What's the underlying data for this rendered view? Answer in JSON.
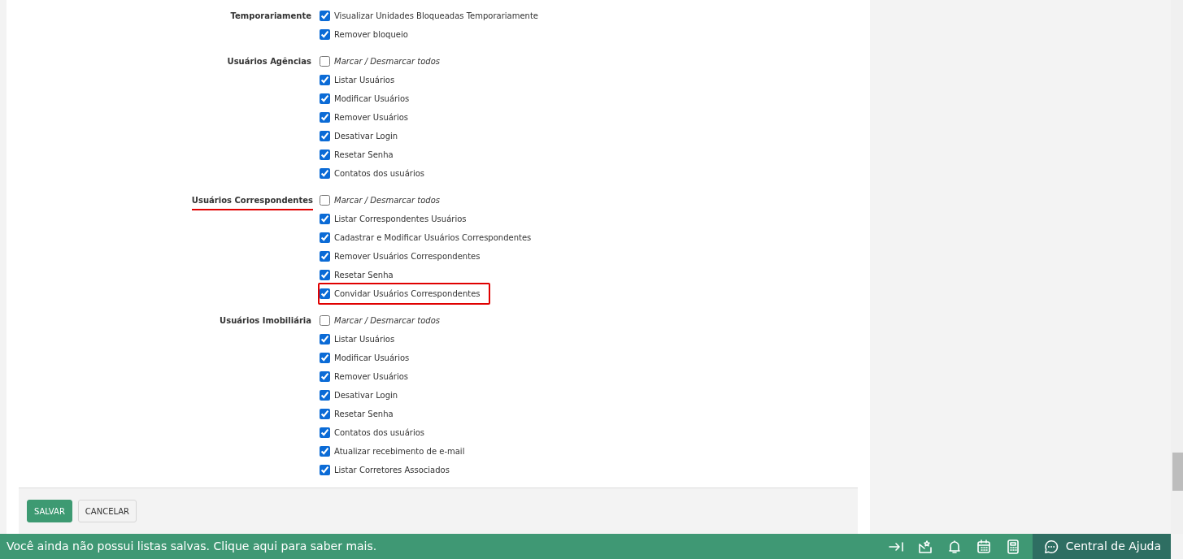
{
  "permission_groups": [
    {
      "label": "Temporariamente",
      "underlined": false,
      "items": [
        {
          "kind": "option",
          "label": "Visualizar Unidades Bloqueadas Temporariamente",
          "checked": true,
          "highlighted": false
        },
        {
          "kind": "option",
          "label": "Remover bloqueio",
          "checked": true,
          "highlighted": false
        }
      ]
    },
    {
      "label": "Usuários Agências",
      "underlined": false,
      "items": [
        {
          "kind": "toggle_all",
          "label": "Marcar / Desmarcar todos",
          "checked": false,
          "highlighted": false
        },
        {
          "kind": "option",
          "label": "Listar Usuários",
          "checked": true,
          "highlighted": false
        },
        {
          "kind": "option",
          "label": "Modificar Usuários",
          "checked": true,
          "highlighted": false
        },
        {
          "kind": "option",
          "label": "Remover Usuários",
          "checked": true,
          "highlighted": false
        },
        {
          "kind": "option",
          "label": "Desativar Login",
          "checked": true,
          "highlighted": false
        },
        {
          "kind": "option",
          "label": "Resetar Senha",
          "checked": true,
          "highlighted": false
        },
        {
          "kind": "option",
          "label": "Contatos dos usuários",
          "checked": true,
          "highlighted": false
        }
      ]
    },
    {
      "label": "Usuários Correspondentes",
      "underlined": true,
      "items": [
        {
          "kind": "toggle_all",
          "label": "Marcar / Desmarcar todos",
          "checked": false,
          "highlighted": false
        },
        {
          "kind": "option",
          "label": "Listar Correspondentes Usuários",
          "checked": true,
          "highlighted": false
        },
        {
          "kind": "option",
          "label": "Cadastrar e Modificar Usuários Correspondentes",
          "checked": true,
          "highlighted": false
        },
        {
          "kind": "option",
          "label": "Remover Usuários Correspondentes",
          "checked": true,
          "highlighted": false
        },
        {
          "kind": "option",
          "label": "Resetar Senha",
          "checked": true,
          "highlighted": false
        },
        {
          "kind": "option",
          "label": "Convidar Usuários Correspondentes",
          "checked": true,
          "highlighted": true
        }
      ]
    },
    {
      "label": "Usuários Imobiliária",
      "underlined": false,
      "items": [
        {
          "kind": "toggle_all",
          "label": "Marcar / Desmarcar todos",
          "checked": false,
          "highlighted": false
        },
        {
          "kind": "option",
          "label": "Listar Usuários",
          "checked": true,
          "highlighted": false
        },
        {
          "kind": "option",
          "label": "Modificar Usuários",
          "checked": true,
          "highlighted": false
        },
        {
          "kind": "option",
          "label": "Remover Usuários",
          "checked": true,
          "highlighted": false
        },
        {
          "kind": "option",
          "label": "Desativar Login",
          "checked": true,
          "highlighted": false
        },
        {
          "kind": "option",
          "label": "Resetar Senha",
          "checked": true,
          "highlighted": false
        },
        {
          "kind": "option",
          "label": "Contatos dos usuários",
          "checked": true,
          "highlighted": false
        },
        {
          "kind": "option",
          "label": "Atualizar recebimento de e-mail",
          "checked": true,
          "highlighted": false
        },
        {
          "kind": "option",
          "label": "Listar Corretores Associados",
          "checked": true,
          "highlighted": false
        }
      ]
    }
  ],
  "buttons": [
    {
      "kind": "primary",
      "label": "SALVAR"
    },
    {
      "kind": "secondary",
      "label": "CANCELAR"
    }
  ],
  "bottom_bar": {
    "message": "Você ainda não possui listas salvas. Clique aqui para saber mais.",
    "tools": [
      {
        "kind": "collapse"
      },
      {
        "kind": "mail"
      },
      {
        "kind": "bell"
      },
      {
        "kind": "calendar"
      },
      {
        "kind": "calculator"
      }
    ],
    "help": "Central de Ajuda"
  }
}
